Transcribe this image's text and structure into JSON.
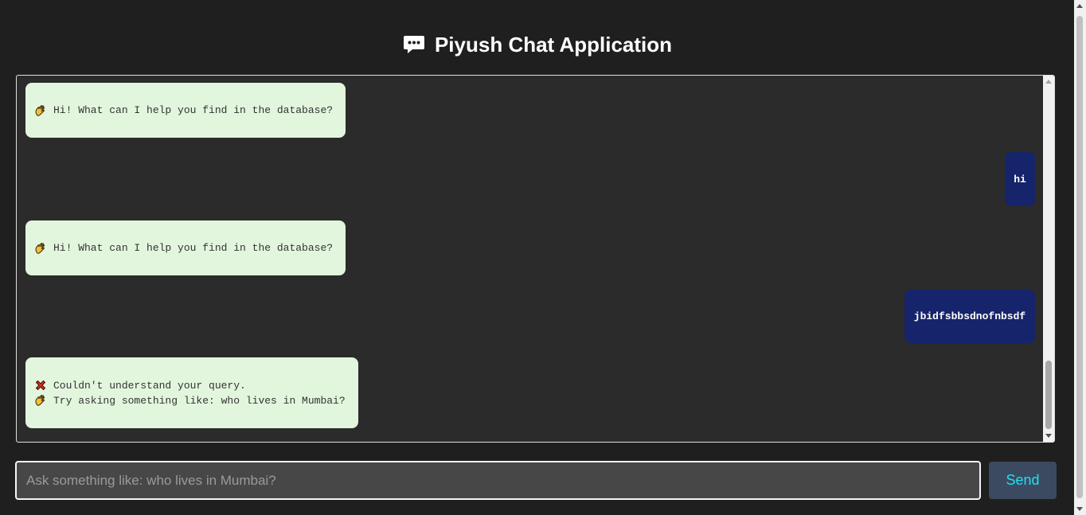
{
  "app": {
    "title": "Piyush Chat Application",
    "title_icon": "speech-bubble-icon"
  },
  "messages": [
    {
      "sender": "bot",
      "lines": [
        {
          "icon": "waving-hand-icon",
          "text": "Hi! What can I help you find in the database?"
        }
      ]
    },
    {
      "sender": "user",
      "text": "hi"
    },
    {
      "sender": "bot",
      "lines": [
        {
          "icon": "waving-hand-icon",
          "text": "Hi! What can I help you find in the database?"
        }
      ]
    },
    {
      "sender": "user",
      "text": "jbidfsbbsdnofnbsdf"
    },
    {
      "sender": "bot",
      "lines": [
        {
          "icon": "cross-mark-icon",
          "text": "Couldn't understand your query."
        },
        {
          "icon": "waving-hand-icon",
          "text": "Try asking something like: who lives in Mumbai?"
        }
      ]
    }
  ],
  "input": {
    "placeholder": "Ask something like: who lives in Mumbai?",
    "value": ""
  },
  "send_button": {
    "label": "Send"
  },
  "colors": {
    "page_background": "#1f1f1f",
    "chat_background": "#2b2b2b",
    "bot_bubble": "#e2f6dd",
    "user_bubble": "#16246b",
    "send_button_bg": "#3b4a60",
    "send_button_text": "#1fe0ef"
  }
}
